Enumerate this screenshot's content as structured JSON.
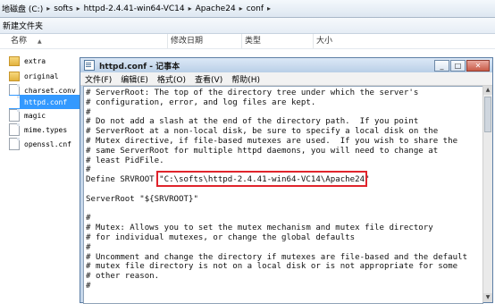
{
  "explorer": {
    "breadcrumbs": [
      "地磁盘 (C:)",
      "softs",
      "httpd-2.4.41-win64-VC14",
      "Apache24",
      "conf"
    ],
    "toolbar": {
      "new_folder": "新建文件夹"
    },
    "columns": {
      "name": "名称",
      "modified": "修改日期",
      "type": "类型",
      "size": "大小"
    },
    "files": [
      {
        "name": "extra",
        "kind": "folder"
      },
      {
        "name": "original",
        "kind": "folder"
      },
      {
        "name": "charset.conv",
        "kind": "file"
      },
      {
        "name": "httpd.conf",
        "kind": "file",
        "selected": true
      },
      {
        "name": "magic",
        "kind": "file"
      },
      {
        "name": "mime.types",
        "kind": "file"
      },
      {
        "name": "openssl.cnf",
        "kind": "file"
      }
    ]
  },
  "notepad": {
    "title": "httpd.conf - 记事本",
    "menu": [
      "文件(F)",
      "编辑(E)",
      "格式(O)",
      "查看(V)",
      "帮助(H)"
    ],
    "lines": [
      "# ServerRoot: The top of the directory tree under which the server's",
      "# configuration, error, and log files are kept.",
      "#",
      "# Do not add a slash at the end of the directory path.  If you point",
      "# ServerRoot at a non-local disk, be sure to specify a local disk on the",
      "# Mutex directive, if file-based mutexes are used.  If you wish to share the",
      "# same ServerRoot for multiple httpd daemons, you will need to change at",
      "# least PidFile.",
      "#",
      "Define SRVROOT \"C:\\softs\\httpd-2.4.41-win64-VC14\\Apache24\"",
      "",
      "ServerRoot \"${SRVROOT}\"",
      "",
      "#",
      "# Mutex: Allows you to set the mutex mechanism and mutex file directory",
      "# for individual mutexes, or change the global defaults",
      "#",
      "# Uncomment and change the directory if mutexes are file-based and the default",
      "# mutex file directory is not on a local disk or is not appropriate for some",
      "# other reason.",
      "#"
    ],
    "highlight_color": "#e0242c"
  }
}
